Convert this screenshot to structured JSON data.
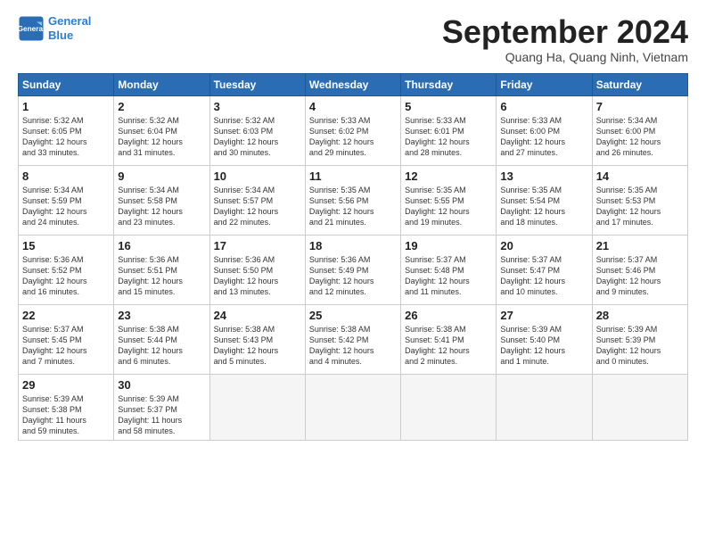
{
  "header": {
    "logo_line1": "General",
    "logo_line2": "Blue",
    "month_title": "September 2024",
    "location": "Quang Ha, Quang Ninh, Vietnam"
  },
  "weekdays": [
    "Sunday",
    "Monday",
    "Tuesday",
    "Wednesday",
    "Thursday",
    "Friday",
    "Saturday"
  ],
  "weeks": [
    [
      {
        "day": "1",
        "sunrise": "5:32 AM",
        "sunset": "6:05 PM",
        "daylight": "12 hours and 33 minutes."
      },
      {
        "day": "2",
        "sunrise": "5:32 AM",
        "sunset": "6:04 PM",
        "daylight": "12 hours and 31 minutes."
      },
      {
        "day": "3",
        "sunrise": "5:32 AM",
        "sunset": "6:03 PM",
        "daylight": "12 hours and 30 minutes."
      },
      {
        "day": "4",
        "sunrise": "5:33 AM",
        "sunset": "6:02 PM",
        "daylight": "12 hours and 29 minutes."
      },
      {
        "day": "5",
        "sunrise": "5:33 AM",
        "sunset": "6:01 PM",
        "daylight": "12 hours and 28 minutes."
      },
      {
        "day": "6",
        "sunrise": "5:33 AM",
        "sunset": "6:00 PM",
        "daylight": "12 hours and 27 minutes."
      },
      {
        "day": "7",
        "sunrise": "5:34 AM",
        "sunset": "6:00 PM",
        "daylight": "12 hours and 26 minutes."
      }
    ],
    [
      {
        "day": "8",
        "sunrise": "5:34 AM",
        "sunset": "5:59 PM",
        "daylight": "12 hours and 24 minutes."
      },
      {
        "day": "9",
        "sunrise": "5:34 AM",
        "sunset": "5:58 PM",
        "daylight": "12 hours and 23 minutes."
      },
      {
        "day": "10",
        "sunrise": "5:34 AM",
        "sunset": "5:57 PM",
        "daylight": "12 hours and 22 minutes."
      },
      {
        "day": "11",
        "sunrise": "5:35 AM",
        "sunset": "5:56 PM",
        "daylight": "12 hours and 21 minutes."
      },
      {
        "day": "12",
        "sunrise": "5:35 AM",
        "sunset": "5:55 PM",
        "daylight": "12 hours and 19 minutes."
      },
      {
        "day": "13",
        "sunrise": "5:35 AM",
        "sunset": "5:54 PM",
        "daylight": "12 hours and 18 minutes."
      },
      {
        "day": "14",
        "sunrise": "5:35 AM",
        "sunset": "5:53 PM",
        "daylight": "12 hours and 17 minutes."
      }
    ],
    [
      {
        "day": "15",
        "sunrise": "5:36 AM",
        "sunset": "5:52 PM",
        "daylight": "12 hours and 16 minutes."
      },
      {
        "day": "16",
        "sunrise": "5:36 AM",
        "sunset": "5:51 PM",
        "daylight": "12 hours and 15 minutes."
      },
      {
        "day": "17",
        "sunrise": "5:36 AM",
        "sunset": "5:50 PM",
        "daylight": "12 hours and 13 minutes."
      },
      {
        "day": "18",
        "sunrise": "5:36 AM",
        "sunset": "5:49 PM",
        "daylight": "12 hours and 12 minutes."
      },
      {
        "day": "19",
        "sunrise": "5:37 AM",
        "sunset": "5:48 PM",
        "daylight": "12 hours and 11 minutes."
      },
      {
        "day": "20",
        "sunrise": "5:37 AM",
        "sunset": "5:47 PM",
        "daylight": "12 hours and 10 minutes."
      },
      {
        "day": "21",
        "sunrise": "5:37 AM",
        "sunset": "5:46 PM",
        "daylight": "12 hours and 9 minutes."
      }
    ],
    [
      {
        "day": "22",
        "sunrise": "5:37 AM",
        "sunset": "5:45 PM",
        "daylight": "12 hours and 7 minutes."
      },
      {
        "day": "23",
        "sunrise": "5:38 AM",
        "sunset": "5:44 PM",
        "daylight": "12 hours and 6 minutes."
      },
      {
        "day": "24",
        "sunrise": "5:38 AM",
        "sunset": "5:43 PM",
        "daylight": "12 hours and 5 minutes."
      },
      {
        "day": "25",
        "sunrise": "5:38 AM",
        "sunset": "5:42 PM",
        "daylight": "12 hours and 4 minutes."
      },
      {
        "day": "26",
        "sunrise": "5:38 AM",
        "sunset": "5:41 PM",
        "daylight": "12 hours and 2 minutes."
      },
      {
        "day": "27",
        "sunrise": "5:39 AM",
        "sunset": "5:40 PM",
        "daylight": "12 hours and 1 minute."
      },
      {
        "day": "28",
        "sunrise": "5:39 AM",
        "sunset": "5:39 PM",
        "daylight": "12 hours and 0 minutes."
      }
    ],
    [
      {
        "day": "29",
        "sunrise": "5:39 AM",
        "sunset": "5:38 PM",
        "daylight": "11 hours and 59 minutes."
      },
      {
        "day": "30",
        "sunrise": "5:39 AM",
        "sunset": "5:37 PM",
        "daylight": "11 hours and 58 minutes."
      },
      null,
      null,
      null,
      null,
      null
    ]
  ]
}
